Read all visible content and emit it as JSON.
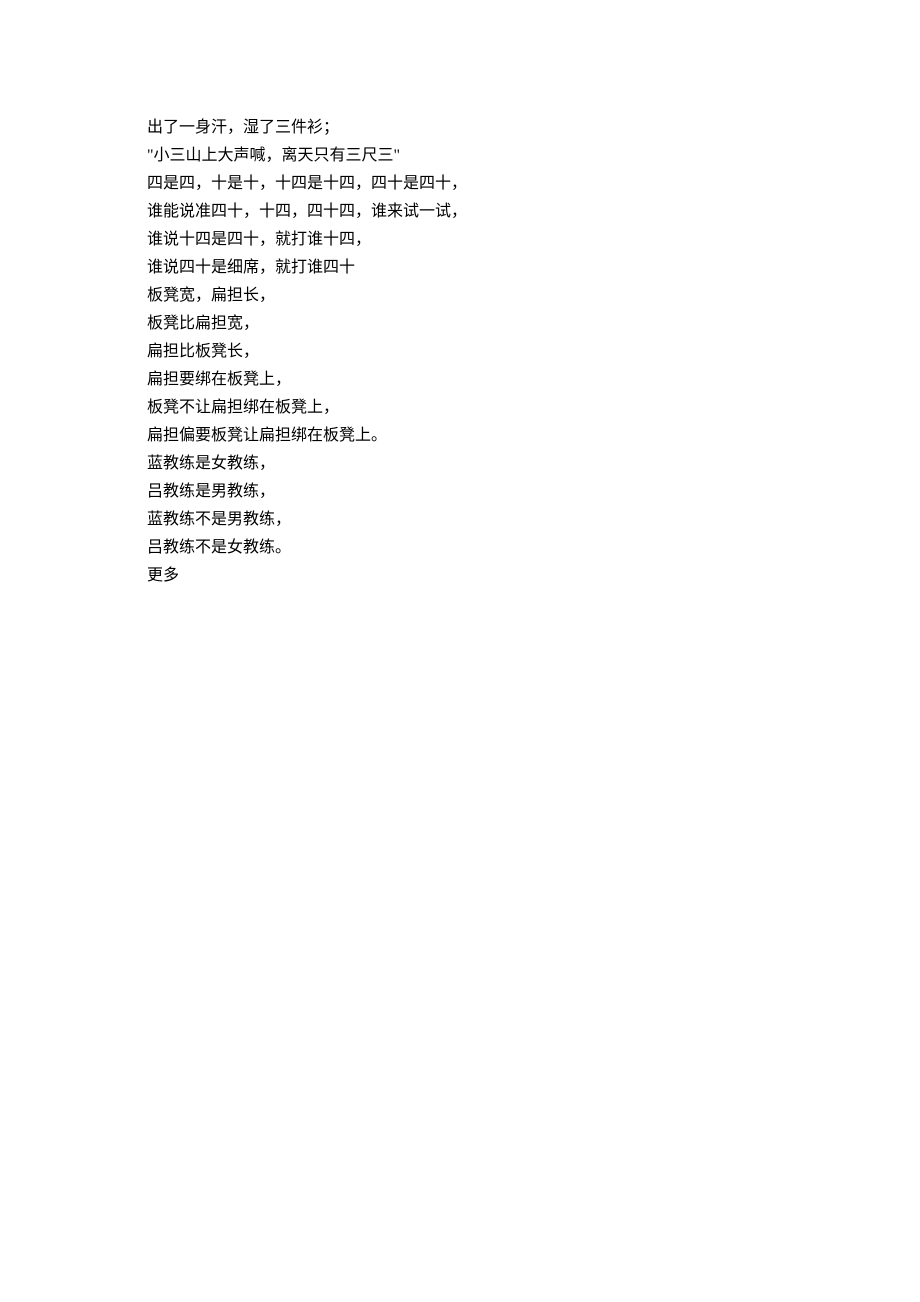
{
  "lines": [
    "出了一身汗，湿了三件衫；",
    "\"小三山上大声喊，离天只有三尺三\"",
    "四是四，十是十，十四是十四，四十是四十，",
    "谁能说准四十，十四，四十四，谁来试一试，",
    "谁说十四是四十，就打谁十四，",
    "谁说四十是细席，就打谁四十",
    "板凳宽，扁担长，",
    "板凳比扁担宽，",
    "扁担比板凳长，",
    "扁担要绑在板凳上，",
    "板凳不让扁担绑在板凳上，",
    "扁担偏要板凳让扁担绑在板凳上。",
    "蓝教练是女教练，",
    "吕教练是男教练，",
    "蓝教练不是男教练，",
    "吕教练不是女教练。",
    "更多"
  ]
}
